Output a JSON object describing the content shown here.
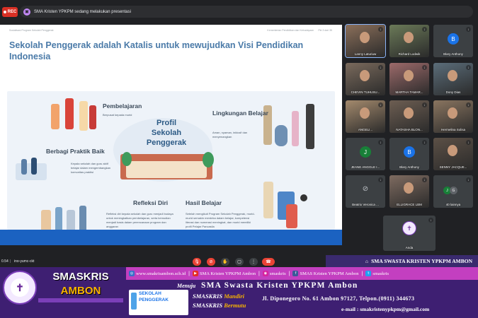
{
  "meet": {
    "rec_label": "REC",
    "presenting_text": "SMA Kristen YPKPM sedang melakukan presentasi",
    "time": "0.54",
    "separator": "|",
    "meeting_code": "ino-yumc-ckt"
  },
  "slide": {
    "header_left": "Sosialisasi Program Sekolah Penggerak",
    "header_right": "Kementerian Pendidikan dan Kebudayaan",
    "header_page": "Pkt 3 dari 35",
    "title": "Sekolah Penggerak adalah Katalis untuk mewujudkan Visi Pendidikan Indonesia",
    "center_title": "Profil Sekolah Penggerak",
    "sections": [
      {
        "title": "Pembelajaran",
        "text": "Berpusat kepada murid"
      },
      {
        "title": "Lingkungan Belajar",
        "text": "Aman, nyaman, inklusif dan menyenangkan"
      },
      {
        "title": "Berbagi Praktik Baik",
        "text": "Kepala sekolah dan guru aktif belajar dalam mengembangkan komunitas praktisi"
      },
      {
        "title": "Refleksi Diri",
        "text": "Refleksi diri kepala sekolah dan guru menjadi budaya untuk meningkatkan pembelajaran, serta kemudian menjadi basis dalam perencanaan program dan anggaran"
      },
      {
        "title": "Hasil Belajar",
        "text": "Setelah mengikuti Program Sekolah Penggerak, murid-murid semakin merdeka dalam belajar, kompetensi literasi dan numerasi meningkat, dan murid memiliki profil Pelajar Pancasila"
      }
    ]
  },
  "participants": [
    {
      "name": "Lanny Laturiuw",
      "type": "video",
      "active": true
    },
    {
      "name": "Richard Lodwik",
      "type": "video"
    },
    {
      "name": "Blary Anthony",
      "type": "avatar",
      "initial": "B",
      "color": "#1a73e8"
    },
    {
      "name": "CHEVIN TUHUSU...",
      "type": "video"
    },
    {
      "name": "MARTHA TAMAR...",
      "type": "video"
    },
    {
      "name": "Dony Dias",
      "type": "video"
    },
    {
      "name": "ANGELI...",
      "type": "video"
    },
    {
      "name": "NATASHA BLON...",
      "type": "video"
    },
    {
      "name": "Hermelina Solisa",
      "type": "video"
    },
    {
      "name": "JEANE ANGGLE I...",
      "type": "avatar",
      "initial": "J",
      "color": "#188038"
    },
    {
      "name": "Blary Anthony",
      "type": "avatar",
      "initial": "B",
      "color": "#1a73e8"
    },
    {
      "name": "SENNY JACQUE...",
      "type": "video"
    },
    {
      "name": "Beatrix Veronica ...",
      "type": "camera-off"
    },
    {
      "name": "ELLIGRACE LBM",
      "type": "video"
    },
    {
      "name": "40 lainnya",
      "type": "others",
      "initials": [
        "J",
        "G"
      ]
    },
    {
      "name": "Anda",
      "type": "self"
    }
  ],
  "banner": {
    "top_title": "SMA SWASTA KRISTEN YPKPM AMBON",
    "brand_line1": "SMASKRIS",
    "brand_line2": "AMBON",
    "logo_symbol": "✝",
    "links": [
      {
        "icon": "globe-icon",
        "text": "www.smakrisambon.sch.id"
      },
      {
        "icon": "youtube-icon",
        "text": "SMA Kristen YPKPM Ambon"
      },
      {
        "icon": "instagram-icon",
        "text": "smaskris"
      },
      {
        "icon": "facebook-icon",
        "text": "SMAS Kristen YPKPM Ambon"
      },
      {
        "icon": "twitter-icon",
        "text": "smaskris"
      }
    ],
    "menuju": "Menuju",
    "school_name": "SMA Swasta Kristen YPKPM Ambon",
    "sp_logo_line1": "SEKOLAH",
    "sp_logo_line2": "PENGGERAK",
    "tag1_a": "SMASKRIS ",
    "tag1_b": "Mandiri",
    "tag2_a": "SMASKRIS ",
    "tag2_b": "Bermutu",
    "address": "Jl. Diponegoro No. 61 Ambon 97127, Telpon.(0911) 344673",
    "email": "e-mail : smakristenypkpm@gmail.com"
  },
  "colors": {
    "banner_purple": "#3e1f72",
    "link_row_magenta": "#c33fc0",
    "slide_title_blue": "#4a7aa8",
    "brand_gold": "#f9b400"
  }
}
